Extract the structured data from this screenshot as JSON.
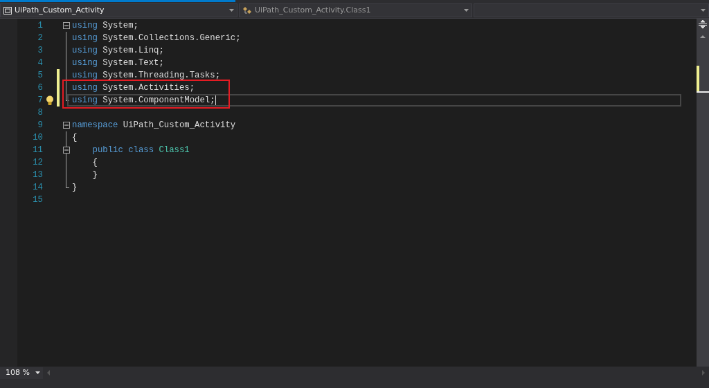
{
  "navigation": {
    "project": "UiPath_Custom_Activity",
    "type": "UiPath_Custom_Activity.Class1"
  },
  "editor": {
    "lines": [
      {
        "number": "1",
        "kind": "start",
        "expanded": true,
        "changed": false,
        "boxed": false,
        "current": false,
        "tokens": [
          {
            "kind": "keyword",
            "text": "using"
          },
          {
            "kind": "plain",
            "text": " System;"
          }
        ]
      },
      {
        "number": "2",
        "kind": "inner",
        "changed": false,
        "boxed": false,
        "current": false,
        "tokens": [
          {
            "kind": "keyword",
            "text": "using"
          },
          {
            "kind": "plain",
            "text": " System.Collections.Generic;"
          }
        ]
      },
      {
        "number": "3",
        "kind": "inner",
        "changed": false,
        "boxed": false,
        "current": false,
        "tokens": [
          {
            "kind": "keyword",
            "text": "using"
          },
          {
            "kind": "plain",
            "text": " System.Linq;"
          }
        ]
      },
      {
        "number": "4",
        "kind": "inner",
        "changed": false,
        "boxed": false,
        "current": false,
        "tokens": [
          {
            "kind": "keyword",
            "text": "using"
          },
          {
            "kind": "plain",
            "text": " System.Text;"
          }
        ]
      },
      {
        "number": "5",
        "kind": "inner",
        "changed": true,
        "boxed": false,
        "current": false,
        "tokens": [
          {
            "kind": "keyword",
            "text": "using"
          },
          {
            "kind": "plain",
            "text": " System.Threading.Tasks;"
          }
        ]
      },
      {
        "number": "6",
        "kind": "inner",
        "changed": true,
        "boxed": true,
        "current": false,
        "tokens": [
          {
            "kind": "keyword",
            "text": "using"
          },
          {
            "kind": "plain",
            "text": " System.Activities;"
          }
        ]
      },
      {
        "number": "7",
        "kind": "end",
        "changed": true,
        "boxed": true,
        "current": true,
        "lightbulb": true,
        "tokens": [
          {
            "kind": "keyword",
            "text": "using"
          },
          {
            "kind": "plain",
            "text": " System.ComponentModel;"
          }
        ]
      },
      {
        "number": "8",
        "kind": "plain",
        "changed": false,
        "boxed": false,
        "current": false
      },
      {
        "number": "9",
        "kind": "start",
        "expanded": true,
        "changed": false,
        "boxed": false,
        "current": false,
        "tokens": [
          {
            "kind": "keyword",
            "text": "namespace"
          },
          {
            "kind": "plain",
            "text": " UiPath_Custom_Activity"
          }
        ]
      },
      {
        "number": "10",
        "kind": "inner",
        "changed": false,
        "boxed": false,
        "current": false,
        "tokens": [
          {
            "kind": "plain",
            "text": "{"
          }
        ]
      },
      {
        "number": "11",
        "kind": "start",
        "expanded": true,
        "changed": false,
        "boxed": false,
        "current": false,
        "tokens": [
          {
            "kind": "keyword",
            "text": "    public class"
          },
          {
            "kind": "type",
            "text": " Class1"
          }
        ]
      },
      {
        "number": "12",
        "kind": "inner",
        "changed": false,
        "boxed": false,
        "current": false,
        "tokens": [
          {
            "kind": "plain",
            "text": "    {"
          }
        ]
      },
      {
        "number": "13",
        "kind": "inner",
        "changed": false,
        "boxed": false,
        "current": false,
        "tokens": [
          {
            "kind": "plain",
            "text": "    }"
          }
        ]
      },
      {
        "number": "14",
        "kind": "end",
        "changed": false,
        "boxed": false,
        "current": false,
        "tokens": [
          {
            "kind": "plain",
            "text": "}"
          }
        ]
      },
      {
        "number": "15",
        "kind": "plain",
        "changed": false,
        "boxed": false,
        "current": false
      }
    ]
  },
  "status": {
    "zoom": "108 %"
  }
}
